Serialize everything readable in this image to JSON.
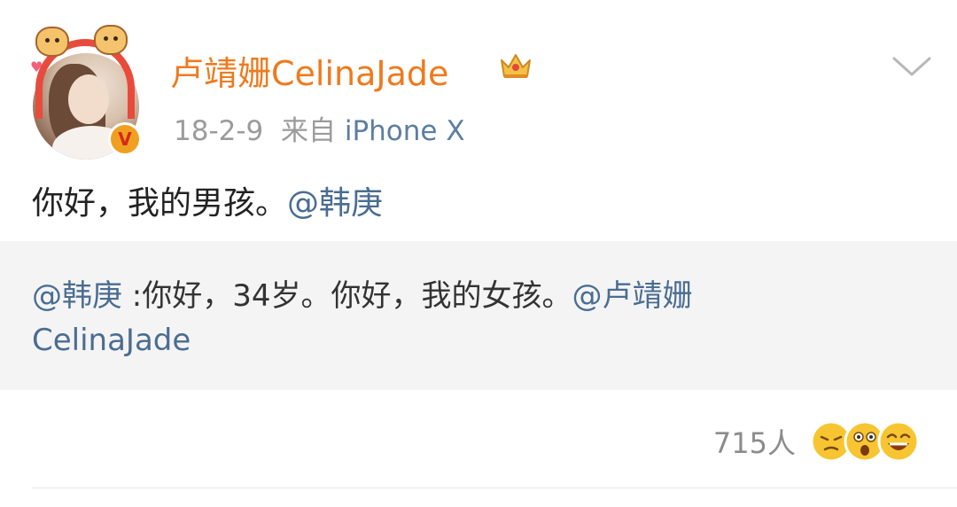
{
  "post": {
    "author": {
      "name": "卢靖姗CelinaJade",
      "verified_badge": "V",
      "badge_icon": "crown-icon"
    },
    "meta": {
      "date": "18-2-9",
      "source_prefix": "来自",
      "source_device": "iPhone X"
    },
    "text_main": "你好，我的男孩。",
    "text_mention": "@韩庚",
    "retweet": {
      "mention": "@韩庚",
      "text": " :你好，34岁。你好，我的女孩。",
      "mention2_line1": "@卢靖姗",
      "mention2_line2": "CelinaJade"
    },
    "reactions": {
      "count": "715人",
      "emojis": [
        "annoyed-face-icon",
        "shocked-face-icon",
        "laughing-face-icon"
      ]
    }
  },
  "colors": {
    "username": "#ef7a1e",
    "link": "#4a6d91",
    "meta": "#9b9b9b",
    "quote_bg": "#f4f4f5"
  }
}
